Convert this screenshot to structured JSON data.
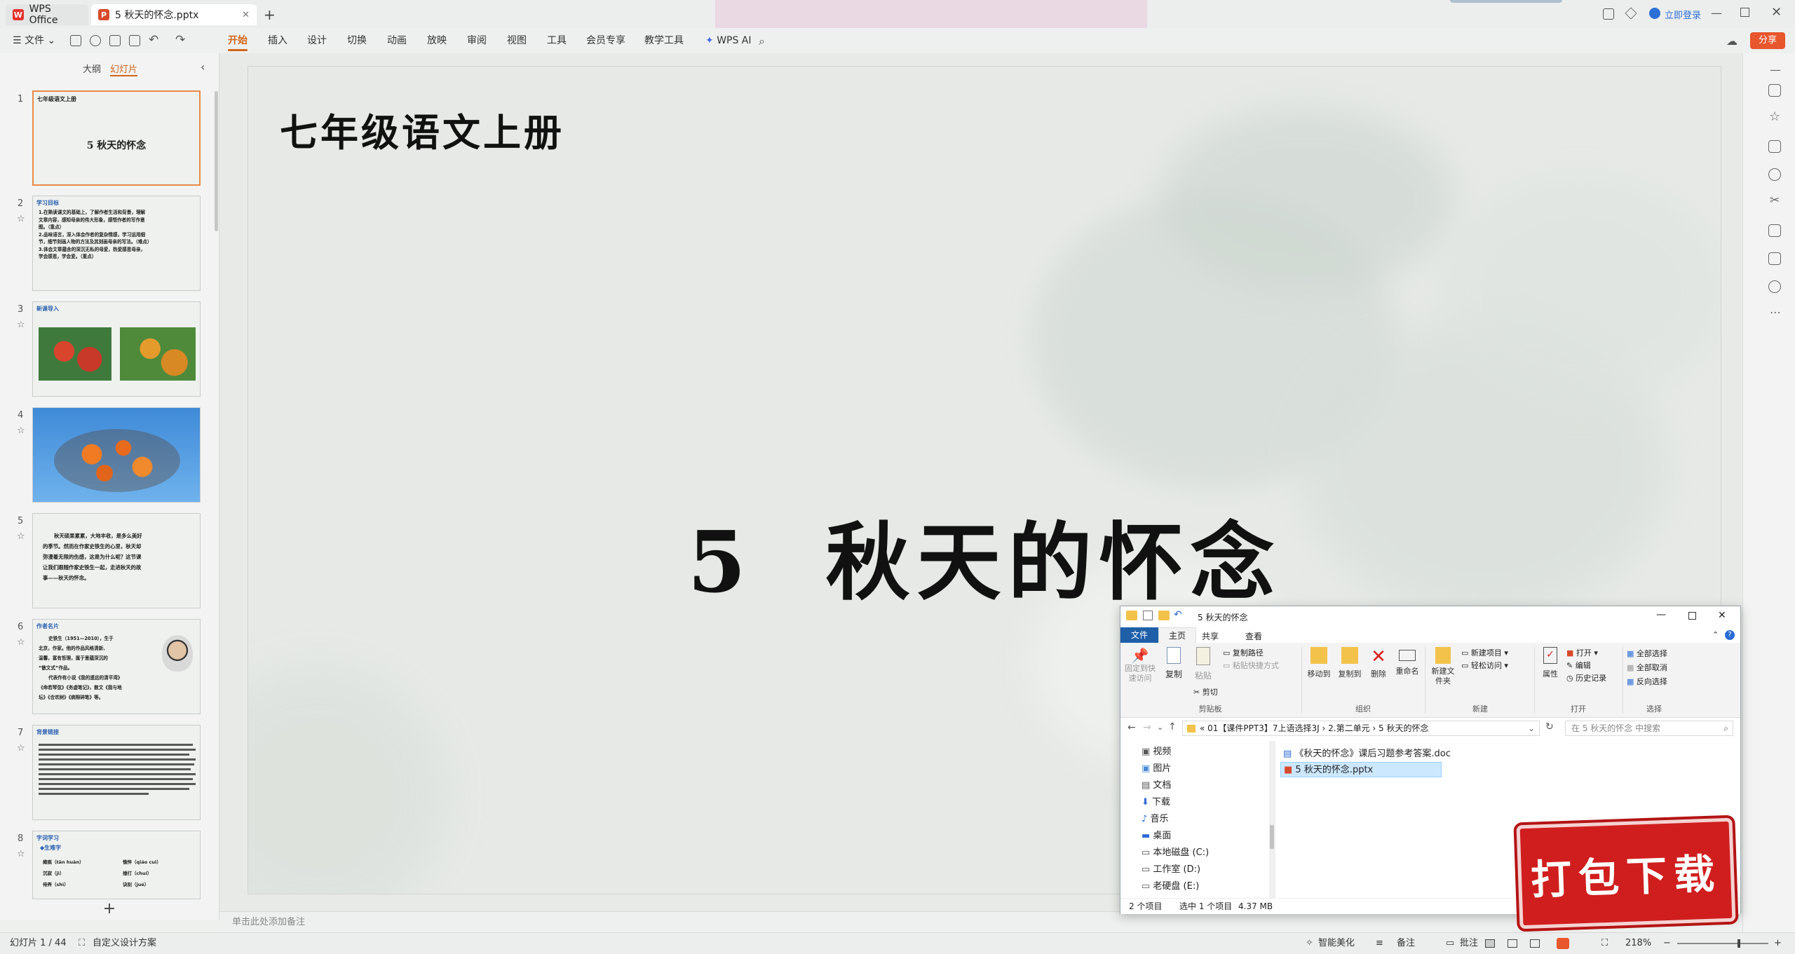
{
  "titlebar": {
    "home_tab": "WPS Office",
    "doc_tab": "5 秋天的怀念.pptx",
    "login": "立即登录"
  },
  "ribbon": {
    "file_menu": "文件",
    "menus": [
      "开始",
      "插入",
      "设计",
      "切换",
      "动画",
      "放映",
      "审阅",
      "视图",
      "工具",
      "会员专享",
      "教学工具"
    ],
    "wps_ai": "WPS AI",
    "share": "分享"
  },
  "leftpanel": {
    "tabs": [
      "大纲",
      "幻灯片"
    ],
    "slides": [
      {
        "num": "1",
        "header": "七年级语文上册",
        "title": "5 秋天的怀念"
      },
      {
        "num": "2",
        "header": "学习目标",
        "lines": [
          "1.在熟读课文的基础上，了解作者生活和背景，理解",
          "文章内容，感知母亲的伟大形象，感悟作者的写作意",
          "图。（重点）",
          "2.品味语言，深入体会作者的复杂情感，学习运用细",
          "节，细节刻画人物的方法及其刻画母亲的写法。（难点）",
          "3.体会文章蕴含的深沉无私的母爱，热爱感恩母亲，",
          "学会感恩，学会爱。（重点）"
        ]
      },
      {
        "num": "3",
        "header": "新课导入"
      },
      {
        "num": "4"
      },
      {
        "num": "5",
        "lines": [
          "秋天硕果累累，大地丰收，是多么美好",
          "的季节。然而在作家史铁生的心里，秋天却",
          "弥漫着无限的伤感，这是为什么呢？这节课",
          "让我们跟随作家史铁生一起，走进秋天的故",
          "事——秋天的怀念。"
        ]
      },
      {
        "num": "6",
        "header": "作者名片",
        "lines": [
          "史铁生（1951—2010），生于",
          "北京，作家。他的作品风格清新、",
          "温馨，富有哲理，属于意蕴深沉的",
          "“散文式”作品。",
          "代表作有小说《我的遥远的清平湾》",
          "《命若琴弦》《务虚笔记》，散文《我与地",
          "坛》《合欢树》《病隙碎笔》等。"
        ]
      },
      {
        "num": "7",
        "header": "背景链接"
      },
      {
        "num": "8",
        "header": "字词学习",
        "sub": "◆生难字",
        "words": [
          "瘫痪（tān huàn）",
          "憔悴（qiáo cuì）",
          "沉寂（jì）",
          "捶打（chuí）",
          "侍弄（shì）",
          "诀别（jué）"
        ]
      }
    ],
    "add": "+"
  },
  "slide": {
    "header": "七年级语文上册",
    "title": "5  秋天的怀念"
  },
  "notes_placeholder": "单击此处添加备注",
  "statusbar": {
    "slide_counter": "幻灯片 1 / 44",
    "custom_design": "自定义设计方案",
    "beautify": "智能美化",
    "notes": "备注",
    "comments": "批注",
    "zoom": "218%"
  },
  "explorer": {
    "title": "5 秋天的怀念",
    "ribbon_tabs": [
      "文件",
      "主页",
      "共享",
      "查看"
    ],
    "groups": {
      "clipboard": {
        "label": "剪贴板",
        "items": [
          "固定到快速访问",
          "复制",
          "粘贴",
          "复制路径",
          "粘贴快捷方式",
          "剪切"
        ]
      },
      "organize": {
        "label": "组织",
        "items": [
          "移动到",
          "复制到",
          "删除",
          "重命名"
        ]
      },
      "new": {
        "label": "新建",
        "items": [
          "新建文件夹",
          "新建项目",
          "轻松访问"
        ]
      },
      "open": {
        "label": "打开",
        "items": [
          "属性",
          "打开",
          "编辑",
          "历史记录"
        ]
      },
      "select": {
        "label": "选择",
        "items": [
          "全部选择",
          "全部取消",
          "反向选择"
        ]
      }
    },
    "breadcrumb": [
      "01【课件PPT3】7上语选择3J",
      "2.第二单元",
      "5 秋天的怀念"
    ],
    "search_placeholder": "在 5 秋天的怀念 中搜索",
    "nav_items": [
      "视频",
      "图片",
      "文档",
      "下载",
      "音乐",
      "桌面",
      "本地磁盘 (C:)",
      "工作室 (D:)",
      "老硬盘 (E:)"
    ],
    "files": [
      "《秋天的怀念》课后习题参考答案.doc",
      "5 秋天的怀念.pptx"
    ],
    "status": {
      "count": "2 个项目",
      "selected": "选中 1 个项目",
      "size": "4.37 MB"
    }
  },
  "download_badge": "打包下载",
  "colors": {
    "accent": "#d2661c",
    "ppt_red": "#d84a2c",
    "badge_red": "#d01e1e",
    "selection": "#cce8ff"
  }
}
